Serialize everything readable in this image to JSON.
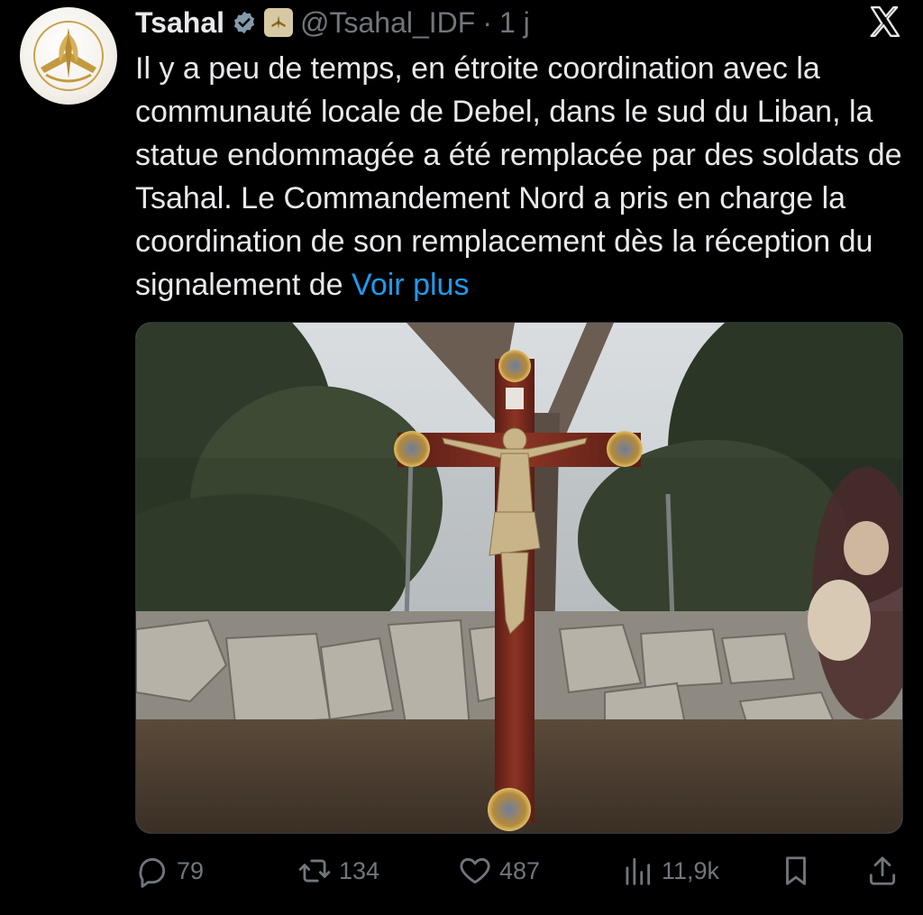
{
  "author": {
    "name": "Tsahal",
    "handle": "@Tsahal_IDF",
    "separator": "·",
    "time": "1 j",
    "verified_color": "#829aab"
  },
  "tweet": {
    "text": "Il y a peu de temps, en étroite coordination avec la communauté locale de Debel, dans le sud du Liban, la statue endommagée a été remplacée par des soldats de Tsahal. Le Commandement Nord a pris en charge la coordination de son remplacement dès la réception du signalement de",
    "see_more": "Voir plus"
  },
  "media": {
    "subject": "Crucifix restored in Debel, southern Lebanon"
  },
  "actions": {
    "replies": "79",
    "reposts": "134",
    "likes": "487",
    "views": "11,9k"
  },
  "icons": {
    "reply": "reply-icon",
    "repost": "repost-icon",
    "like": "heart-icon",
    "views": "views-chart-icon",
    "bookmark": "bookmark-icon",
    "share": "share-icon",
    "brand": "x-logo-icon"
  },
  "colors": {
    "background": "#000000",
    "text": "#e7e9ea",
    "muted": "#71767b",
    "link": "#1d9bf0"
  }
}
